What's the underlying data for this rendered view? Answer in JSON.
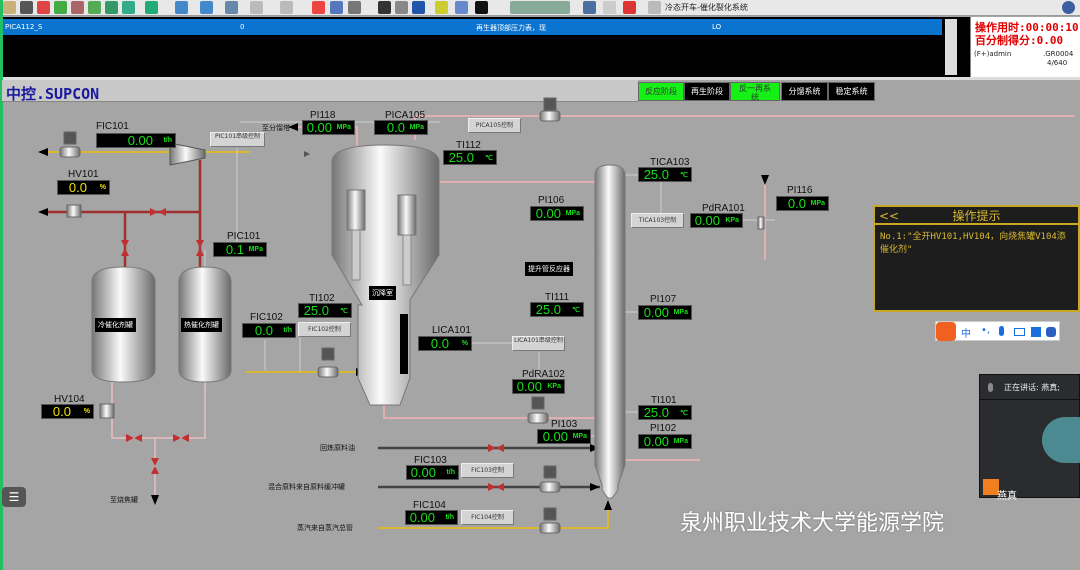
{
  "window": {
    "title": "冷态开车-催化裂化系统"
  },
  "alarm": {
    "row": {
      "tag": "PICA112_S",
      "value": "0",
      "desc": "再生器顶部压力表，现",
      "level": "LO"
    }
  },
  "status": {
    "time": "操作用时:00:00:10",
    "score": "百分制得分:0.00",
    "user": "(F+)admin",
    "group": ".GR0004",
    "page": "4/640"
  },
  "header": {
    "brand": "中控.SUPCON"
  },
  "nav": [
    {
      "label": "反应阶段",
      "active": true
    },
    {
      "label": "再生阶段",
      "active": false
    },
    {
      "label": "反一再系统",
      "active": true
    },
    {
      "label": "分馏系统",
      "active": false
    },
    {
      "label": "稳定系统",
      "active": false
    }
  ],
  "displays": {
    "FIC101": {
      "tag": "FIC101",
      "value": "0.00",
      "unit": "t/h"
    },
    "HV101": {
      "tag": "HV101",
      "value": "0.0",
      "unit": "%"
    },
    "PIC101": {
      "tag": "PIC101",
      "value": "0.1",
      "unit": "MPa"
    },
    "PI118": {
      "tag": "PI118",
      "value": "0.00",
      "unit": "MPa"
    },
    "PICA105": {
      "tag": "PICA105",
      "value": "0.0",
      "unit": "MPa"
    },
    "TI112": {
      "tag": "TI112",
      "value": "25.0",
      "unit": "℃"
    },
    "PI106": {
      "tag": "PI106",
      "value": "0.00",
      "unit": "MPa"
    },
    "TICA103": {
      "tag": "TICA103",
      "value": "25.0",
      "unit": "℃"
    },
    "PdRA101": {
      "tag": "PdRA101",
      "value": "0.00",
      "unit": "KPa"
    },
    "PI116": {
      "tag": "PI116",
      "value": "0.0",
      "unit": "MPa"
    },
    "TI102": {
      "tag": "TI102",
      "value": "25.0",
      "unit": "℃"
    },
    "FIC102": {
      "tag": "FIC102",
      "value": "0.0",
      "unit": "t/h"
    },
    "LICA101": {
      "tag": "LICA101",
      "value": "0.0",
      "unit": "%"
    },
    "TI111": {
      "tag": "TI111",
      "value": "25.0",
      "unit": "℃"
    },
    "PI107": {
      "tag": "PI107",
      "value": "0.00",
      "unit": "MPa"
    },
    "PdRA102": {
      "tag": "PdRA102",
      "value": "0.00",
      "unit": "KPa"
    },
    "PI103": {
      "tag": "PI103",
      "value": "0.00",
      "unit": "MPa"
    },
    "TI101": {
      "tag": "TI101",
      "value": "25.0",
      "unit": "℃"
    },
    "PI102": {
      "tag": "PI102",
      "value": "0.00",
      "unit": "MPa"
    },
    "FIC103": {
      "tag": "FIC103",
      "value": "0.00",
      "unit": "t/h"
    },
    "FIC104": {
      "tag": "FIC104",
      "value": "0.00",
      "unit": "t/h"
    },
    "HV104": {
      "tag": "HV104",
      "value": "0.0",
      "unit": "%"
    }
  },
  "controls": {
    "PIC101": "PIC101串级控制",
    "PICA105": "PICA105控制",
    "TICA103": "TICA103控制",
    "FIC102": "FIC102控制",
    "LICA101": "LICA101串级控制",
    "FIC103": "FIC103控制",
    "FIC104": "FIC104控制"
  },
  "labels": {
    "to_fractionator": "至分馏塔",
    "to_burner": "至烧焦罐",
    "recycle_oil": "回炼原料油",
    "mixed_feed": "混合原料来自原料缓冲罐",
    "steam": "蒸汽来自蒸汽总管",
    "riser": "提升管反应器",
    "settler": "沉降室",
    "cold_tank": "冷催化剂罐",
    "hot_tank": "热催化剂罐"
  },
  "tips": {
    "back": "<<",
    "title": "操作提示",
    "text1": "No.1:\"全开HV101,HV104，向烧焦罐V104添",
    "text2": "催化剂\""
  },
  "ime": {
    "lang": "中",
    "punct": "•,"
  },
  "meeting": {
    "speaking": "正在讲话: 燕真;",
    "speaker": "燕真"
  },
  "watermark": "泉州职业技术大学能源学院",
  "colors": {
    "display_value": "#18e018",
    "manual_value": "#f0e000",
    "nav_active": "#16f016",
    "alarm_row": "#0a74d0",
    "score_text": "#e00000"
  }
}
